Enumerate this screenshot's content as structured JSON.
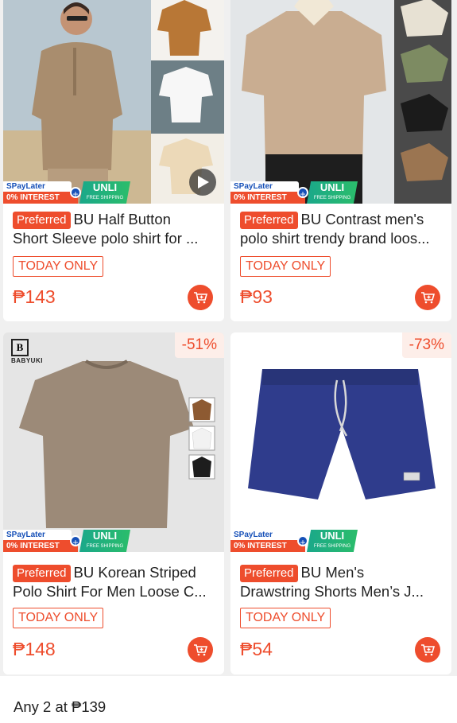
{
  "colors": {
    "accent": "#ee4d2d",
    "blue": "#1650b8",
    "green": "#1aa88a"
  },
  "promo": {
    "spay": "SPayLater",
    "interest": "0% INTEREST",
    "unli": "UNLI",
    "free_shipping": "FREE SHIPPING"
  },
  "products": [
    {
      "preferred": "Preferred",
      "title_line1": "BU Half Button",
      "title_line2": "Short Sleeve polo shirt for ...",
      "badge": "TODAY ONLY",
      "price": "₱143",
      "has_video": true
    },
    {
      "preferred": "Preferred",
      "title_line1": "BU Contrast men's",
      "title_line2": "polo shirt trendy brand loos...",
      "badge": "TODAY ONLY",
      "price": "₱93"
    },
    {
      "discount": "-51%",
      "brand": "BABYUKI",
      "brand_mark": "B",
      "preferred": "Preferred",
      "title_line1": "BU Korean Striped",
      "title_line2": "Polo Shirt For Men Loose C...",
      "badge": "TODAY ONLY",
      "price": "₱148"
    },
    {
      "discount": "-73%",
      "preferred": "Preferred",
      "title_line1": "BU Men's",
      "title_line2": "Drawstring Shorts Men’s J...",
      "badge": "TODAY ONLY",
      "price": "₱54"
    }
  ],
  "footer": {
    "text": "Any 2 at ₱139"
  }
}
